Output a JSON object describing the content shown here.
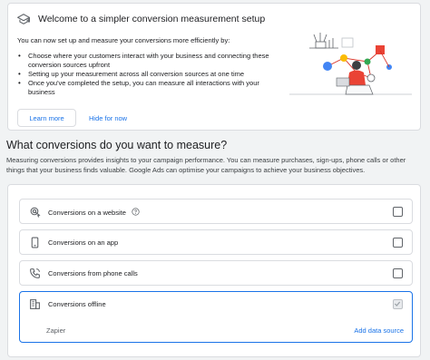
{
  "banner": {
    "icon": "graduation-cap-icon",
    "title": "Welcome to a simpler conversion measurement setup",
    "intro": "You can now set up and measure your conversions more efficiently by:",
    "bullets": [
      "Choose where your customers interact with your business and connecting these conversion sources upfront",
      "Setting up your measurement across all conversion sources at one time",
      "Once you've completed the setup, you can measure all interactions with your business"
    ],
    "learn_more": "Learn more",
    "hide": "Hide for now"
  },
  "section": {
    "title": "What conversions do you want to measure?",
    "description": "Measuring conversions provides insights to your campaign performance. You can measure purchases, sign-ups, phone calls or other things that your business finds valuable. Google Ads can optimise your campaigns to achieve your business objectives."
  },
  "options": [
    {
      "label": "Conversions on a website",
      "icon": "cursor-click-icon",
      "checked": false,
      "help_icon": "help-circle-icon"
    },
    {
      "label": "Conversions on an app",
      "icon": "phone-icon",
      "checked": false
    },
    {
      "label": "Conversions from phone calls",
      "icon": "phone-call-icon",
      "checked": false
    },
    {
      "label": "Conversions offline",
      "icon": "building-icon",
      "checked": true,
      "source": "Zapier",
      "add_source": "Add data source"
    }
  ],
  "colors": {
    "accent": "#1a73e8",
    "border": "#dadce0",
    "background": "#f1f3f4"
  }
}
